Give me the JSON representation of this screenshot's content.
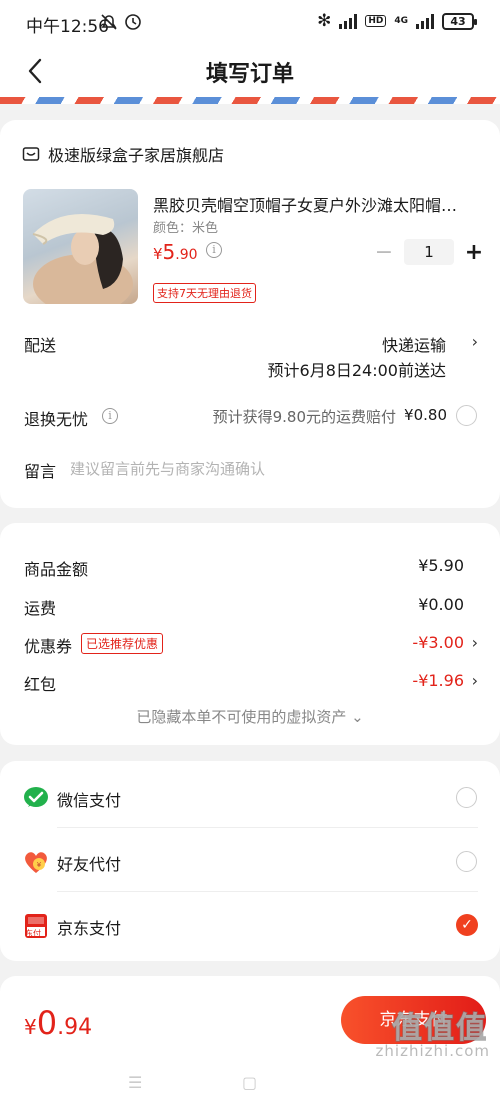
{
  "status_bar": {
    "time": "中午12:56",
    "network": "4G",
    "battery": "43"
  },
  "header": {
    "title": "填写订单"
  },
  "shop": {
    "name": "极速版绿盒子家居旗舰店",
    "product": {
      "title": "黑胶贝壳帽空顶帽子女夏户外沙滩太阳帽…",
      "color": "颜色：米色",
      "price_symbol": "¥",
      "price_int": "5",
      "price_dec": ".90",
      "return_tag": "支持7天无理由退货",
      "quantity": "1"
    },
    "shipping": {
      "label": "配送",
      "method": "快递运输",
      "eta": "预计6月8日24:00前送达"
    },
    "returns": {
      "label": "退换无忧",
      "text": "预计获得9.80元的运费赔付",
      "price": "¥0.80"
    },
    "note": {
      "label": "留言",
      "placeholder": "建议留言前先与商家沟通确认"
    }
  },
  "amounts": {
    "goods_label": "商品金额",
    "goods_value": "¥5.90",
    "freight_label": "运费",
    "freight_value": "¥0.00",
    "coupon_label": "优惠券",
    "coupon_tag": "已选推荐优惠",
    "coupon_value": "-¥3.00",
    "redpacket_label": "红包",
    "redpacket_value": "-¥1.96",
    "hidden_assets": "已隐藏本单不可使用的虚拟资产"
  },
  "payment": {
    "options": [
      {
        "label": "微信支付",
        "selected": false
      },
      {
        "label": "好友代付",
        "selected": false
      },
      {
        "label": "京东支付",
        "selected": true
      }
    ],
    "jd_icon_text": "东付"
  },
  "bottom": {
    "total_symbol": "¥",
    "total_int": "0",
    "total_dec": ".94",
    "pay_button": "京东支付"
  },
  "watermark": {
    "text": "zhizhizhi.com",
    "logo": "值值值"
  },
  "colors": {
    "accent": "#e2231a",
    "wechat": "#22b14c",
    "button": "#f0401f"
  }
}
